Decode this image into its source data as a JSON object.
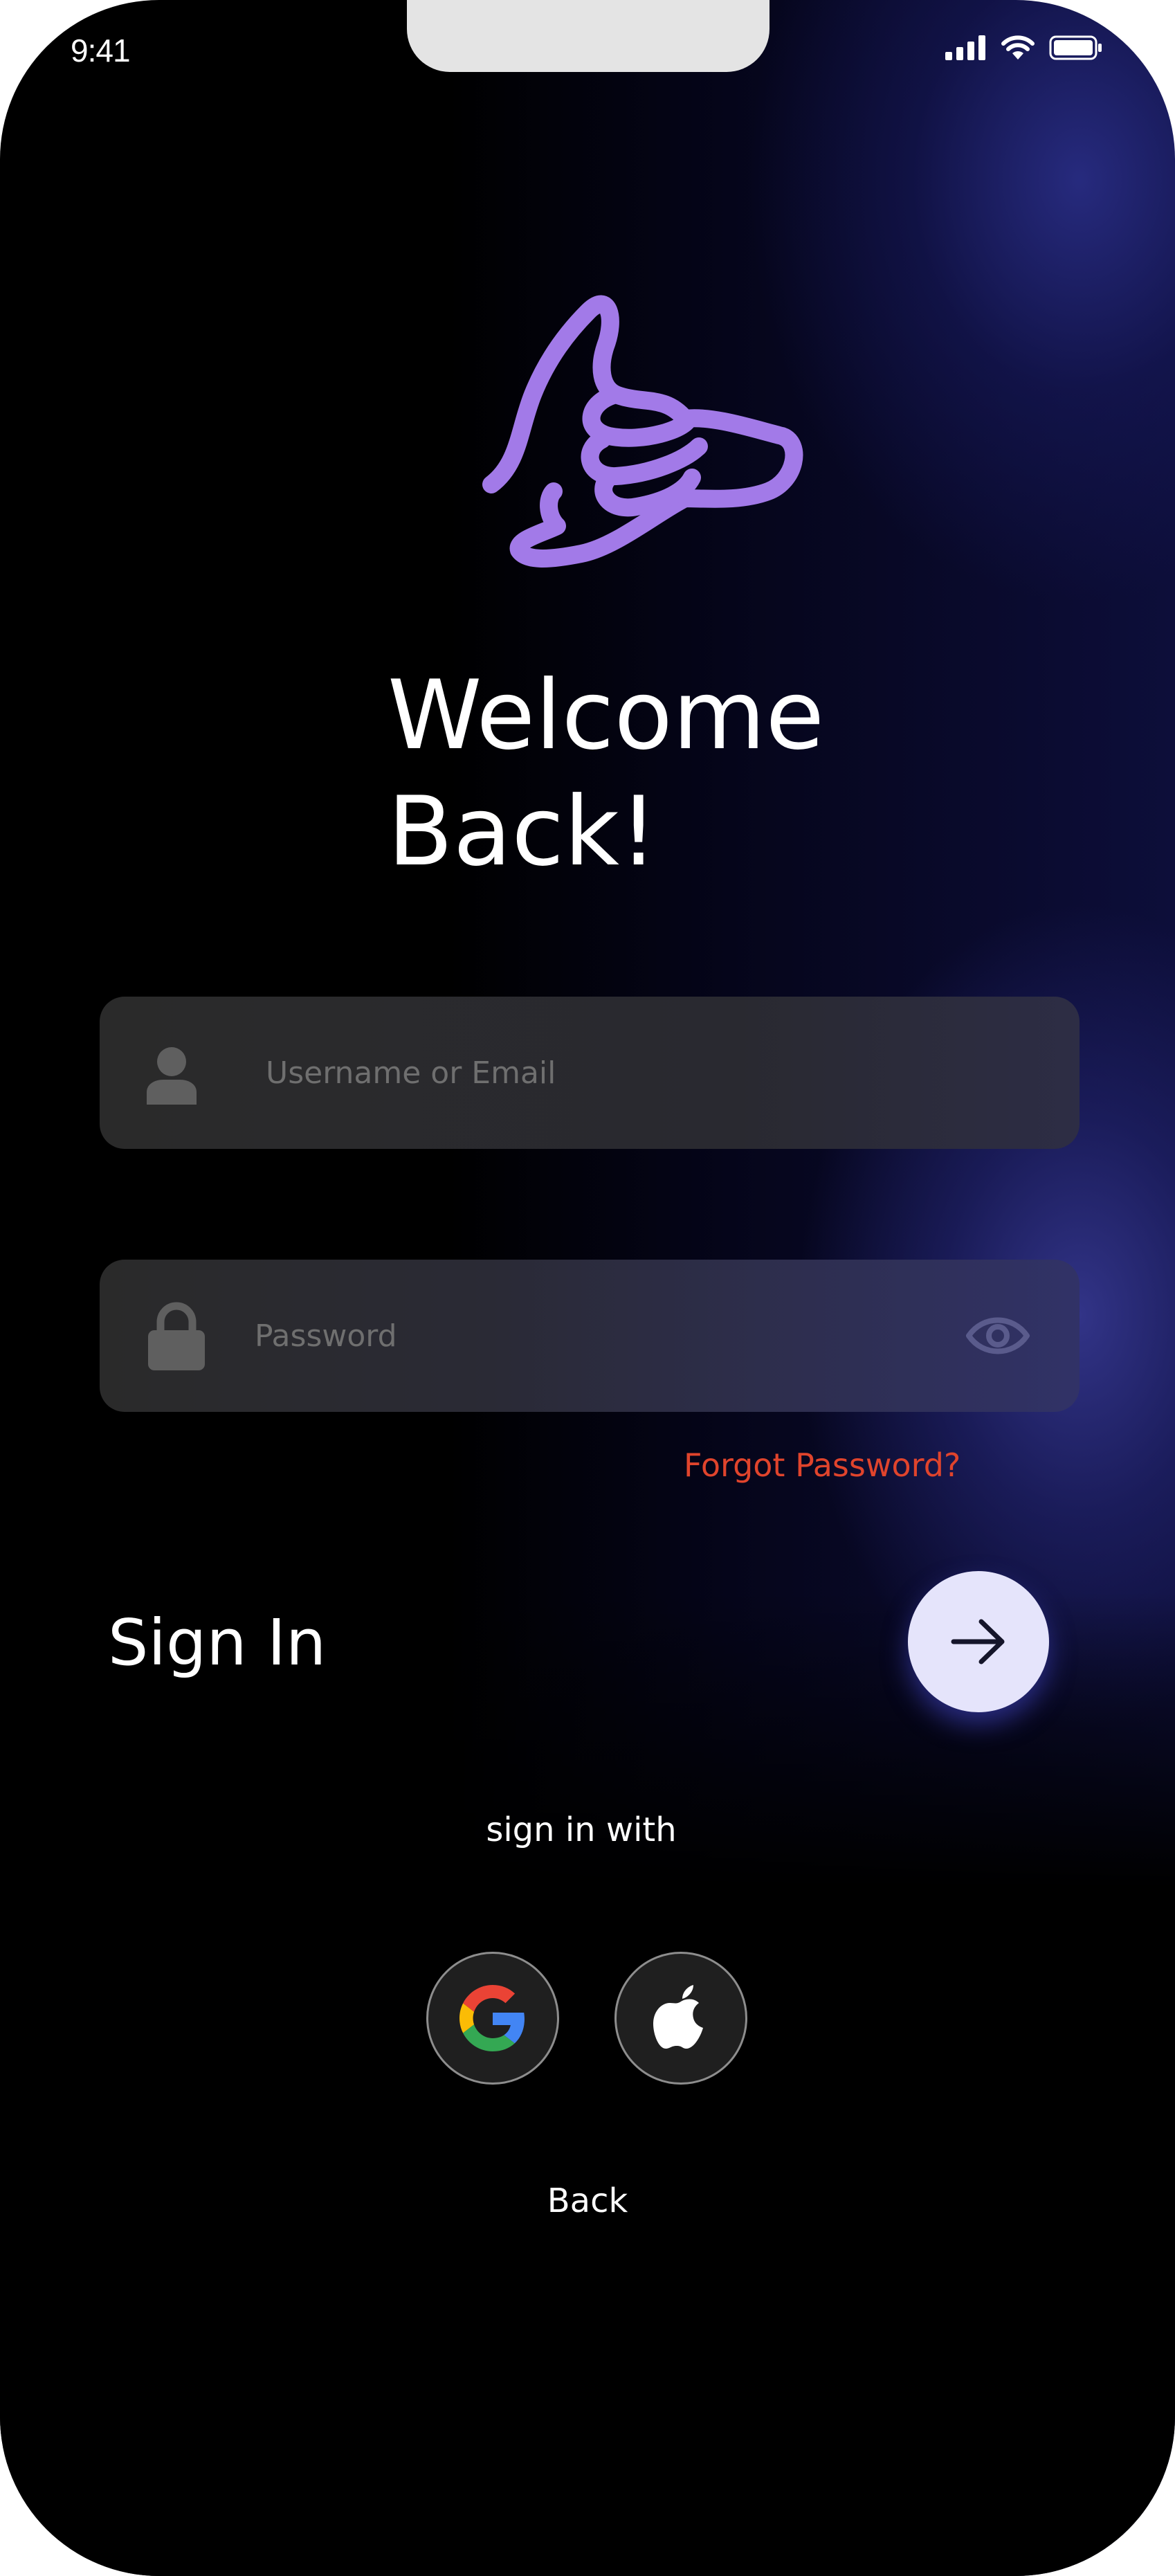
{
  "status_bar": {
    "time": "9:41"
  },
  "icons": {
    "signal": "cellular-signal-icon",
    "wifi": "wifi-icon",
    "battery": "battery-icon",
    "logo": "shaka-hand-logo",
    "user": "user-icon",
    "lock": "lock-icon",
    "eye": "eye-icon",
    "arrow": "arrow-right-icon",
    "google": "google-icon",
    "apple": "apple-icon"
  },
  "title": {
    "line1": "Welcome",
    "line2": "Back!"
  },
  "form": {
    "username_placeholder": "Username or Email",
    "username_value": "",
    "password_placeholder": "Password",
    "password_value": "",
    "forgot_password": "Forgot Password?",
    "sign_in_label": "Sign In"
  },
  "social": {
    "label": "sign in with"
  },
  "footer": {
    "back_label": "Back"
  },
  "colors": {
    "logo": "#a27ae8",
    "forgot_link": "#e0442c",
    "submit_button": "#e5e4fb",
    "background": "#000000",
    "accent_glow": "#34368c"
  }
}
